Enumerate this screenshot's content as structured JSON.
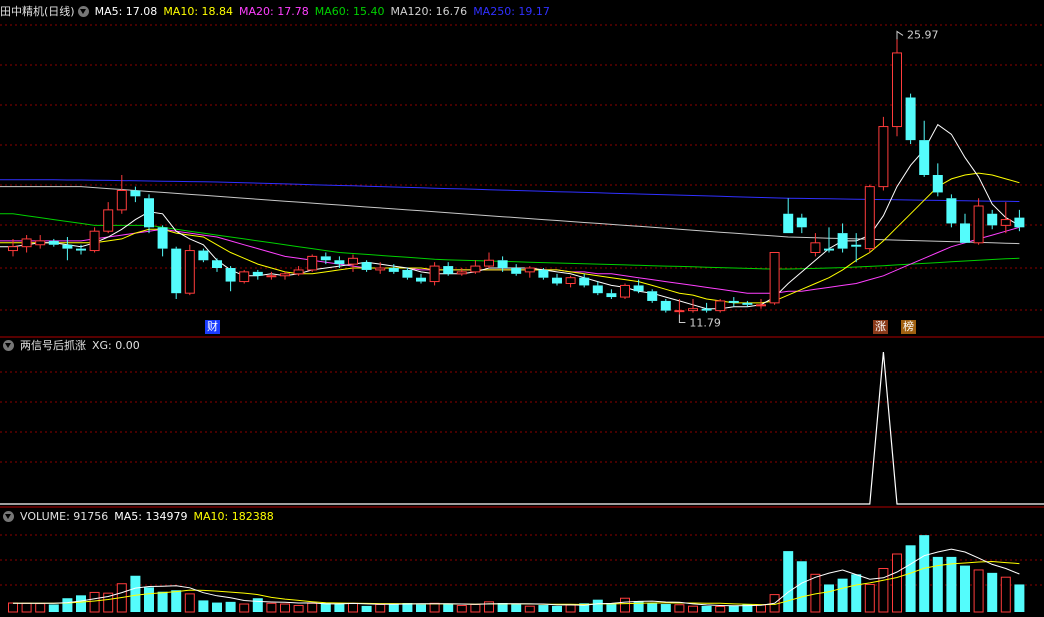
{
  "main_header": {
    "title": "田中精机(日线)",
    "ma5": "MA5: 17.08",
    "ma10": "MA10: 18.84",
    "ma20": "MA20: 17.78",
    "ma60": "MA60: 15.40",
    "ma120": "MA120: 16.76",
    "ma250": "MA250: 19.17"
  },
  "indicator_header": {
    "title": "两信号后抓涨",
    "xg": "XG: 0.00"
  },
  "volume_header": {
    "volume": "VOLUME: 91756",
    "ma5": "MA5: 134979",
    "ma10": "MA10: 182388"
  },
  "annotations": {
    "high": "25.97",
    "low": "11.79",
    "tag_cai": "财",
    "tag_zhang": "涨",
    "tag_bang": "榜"
  },
  "colors": {
    "up": "#ff3c3c",
    "down": "#54fcfc",
    "ma5": "#ffffff",
    "ma10": "#ffff00",
    "ma20": "#ff40ff",
    "ma60": "#00d000",
    "ma120": "#c8c8c8",
    "ma250": "#3030ff",
    "grid": "#8b0000"
  },
  "chart_data": [
    {
      "type": "candlestick",
      "title": "田中精机(日线)",
      "ylim": [
        11.0,
        27.0
      ],
      "candles": [
        [
          15.1,
          15.7,
          14.8,
          15.3
        ],
        [
          15.3,
          15.9,
          15.0,
          15.7
        ],
        [
          15.4,
          15.9,
          15.2,
          15.6
        ],
        [
          15.6,
          15.7,
          15.3,
          15.4
        ],
        [
          15.4,
          15.8,
          14.6,
          15.2
        ],
        [
          15.2,
          15.4,
          14.9,
          15.1
        ],
        [
          15.1,
          16.3,
          15.0,
          16.1
        ],
        [
          16.1,
          17.6,
          16.0,
          17.2
        ],
        [
          17.2,
          19.0,
          17.0,
          18.2
        ],
        [
          18.2,
          18.4,
          17.6,
          17.9
        ],
        [
          17.8,
          18.0,
          16.0,
          16.3
        ],
        [
          16.3,
          16.4,
          14.8,
          15.2
        ],
        [
          15.2,
          15.3,
          12.6,
          12.9
        ],
        [
          12.9,
          15.4,
          12.8,
          15.1
        ],
        [
          15.1,
          15.2,
          14.5,
          14.6
        ],
        [
          14.6,
          14.7,
          14.0,
          14.2
        ],
        [
          14.2,
          14.3,
          13.0,
          13.5
        ],
        [
          13.5,
          14.1,
          13.4,
          14.0
        ],
        [
          14.0,
          14.1,
          13.6,
          13.8
        ],
        [
          13.8,
          14.0,
          13.6,
          13.8
        ],
        [
          13.8,
          14.0,
          13.6,
          13.9
        ],
        [
          13.9,
          14.3,
          13.8,
          14.1
        ],
        [
          14.1,
          14.9,
          14.0,
          14.8
        ],
        [
          14.8,
          15.0,
          14.4,
          14.6
        ],
        [
          14.6,
          14.8,
          14.2,
          14.4
        ],
        [
          14.4,
          14.9,
          14.0,
          14.7
        ],
        [
          14.5,
          14.6,
          14.0,
          14.1
        ],
        [
          14.1,
          14.5,
          13.9,
          14.2
        ],
        [
          14.2,
          14.4,
          13.9,
          14.0
        ],
        [
          14.1,
          14.2,
          13.6,
          13.7
        ],
        [
          13.7,
          13.9,
          13.4,
          13.5
        ],
        [
          13.5,
          14.5,
          13.3,
          14.3
        ],
        [
          14.3,
          14.5,
          13.8,
          13.9
        ],
        [
          13.9,
          14.2,
          13.8,
          14.0
        ],
        [
          14.0,
          14.6,
          13.9,
          14.3
        ],
        [
          14.3,
          15.0,
          14.2,
          14.6
        ],
        [
          14.6,
          14.8,
          14.0,
          14.2
        ],
        [
          14.2,
          14.4,
          13.8,
          13.9
        ],
        [
          14.0,
          14.3,
          13.7,
          14.2
        ],
        [
          14.1,
          14.2,
          13.6,
          13.7
        ],
        [
          13.7,
          13.9,
          13.3,
          13.4
        ],
        [
          13.4,
          13.8,
          13.2,
          13.7
        ],
        [
          13.7,
          13.9,
          13.2,
          13.3
        ],
        [
          13.3,
          13.5,
          12.8,
          12.9
        ],
        [
          12.9,
          13.1,
          12.6,
          12.7
        ],
        [
          12.7,
          13.4,
          12.6,
          13.3
        ],
        [
          13.3,
          13.6,
          12.9,
          13.0
        ],
        [
          13.0,
          13.1,
          12.4,
          12.5
        ],
        [
          12.5,
          12.6,
          11.9,
          12.0
        ],
        [
          12.0,
          12.6,
          11.8,
          12.0
        ],
        [
          12.0,
          12.6,
          11.9,
          12.1
        ],
        [
          12.1,
          12.4,
          11.9,
          12.0
        ],
        [
          12.0,
          12.6,
          11.9,
          12.5
        ],
        [
          12.5,
          12.7,
          12.2,
          12.4
        ],
        [
          12.4,
          12.5,
          12.2,
          12.3
        ],
        [
          12.3,
          12.6,
          12.1,
          12.3
        ],
        [
          12.4,
          15.0,
          12.3,
          15.0
        ],
        [
          17.0,
          17.8,
          16.0,
          16.0
        ],
        [
          16.8,
          17.0,
          16.0,
          16.3
        ],
        [
          15.0,
          16.0,
          14.8,
          15.5
        ],
        [
          15.2,
          16.3,
          15.0,
          15.1
        ],
        [
          16.0,
          16.5,
          15.0,
          15.2
        ],
        [
          15.4,
          16.0,
          14.5,
          15.3
        ],
        [
          15.2,
          18.5,
          15.0,
          18.4
        ],
        [
          18.4,
          22.0,
          18.2,
          21.5
        ],
        [
          21.5,
          26.0,
          21.0,
          25.3
        ],
        [
          23.0,
          23.2,
          20.6,
          20.8
        ],
        [
          20.8,
          21.8,
          18.9,
          19.0
        ],
        [
          19.0,
          19.6,
          17.9,
          18.1
        ],
        [
          17.8,
          18.0,
          16.3,
          16.5
        ],
        [
          16.5,
          17.0,
          15.5,
          15.5
        ],
        [
          15.5,
          17.8,
          15.4,
          17.4
        ],
        [
          17.0,
          17.2,
          16.2,
          16.4
        ],
        [
          16.4,
          17.6,
          16.0,
          16.7
        ],
        [
          16.8,
          17.2,
          16.1,
          16.3
        ]
      ],
      "ma5": [
        15.3,
        15.4,
        15.5,
        15.5,
        15.4,
        15.3,
        15.5,
        15.8,
        16.2,
        16.7,
        17.1,
        17.0,
        16.1,
        15.7,
        15.4,
        14.6,
        14.1,
        13.8,
        13.8,
        13.9,
        13.8,
        13.9,
        14.1,
        14.2,
        14.3,
        14.4,
        14.5,
        14.4,
        14.3,
        14.2,
        14.0,
        13.9,
        13.9,
        13.9,
        14.0,
        14.2,
        14.2,
        14.2,
        14.2,
        14.1,
        14.0,
        13.9,
        13.7,
        13.5,
        13.3,
        13.2,
        13.0,
        12.9,
        12.7,
        12.5,
        12.3,
        12.1,
        12.1,
        12.2,
        12.2,
        12.3,
        12.7,
        13.4,
        14.0,
        14.6,
        15.2,
        15.6,
        15.6,
        15.9,
        16.9,
        18.4,
        19.5,
        20.3,
        21.6,
        21.1,
        19.9,
        18.9,
        17.5,
        16.8,
        16.4
      ],
      "ma10": [
        15.5,
        15.5,
        15.5,
        15.5,
        15.5,
        15.5,
        15.5,
        15.6,
        15.7,
        16.0,
        16.2,
        16.2,
        16.0,
        15.9,
        15.8,
        15.4,
        15.0,
        14.7,
        14.4,
        14.2,
        14.0,
        13.9,
        13.9,
        14.0,
        14.1,
        14.2,
        14.2,
        14.2,
        14.2,
        14.2,
        14.2,
        14.1,
        14.1,
        14.1,
        14.1,
        14.1,
        14.1,
        14.1,
        14.1,
        14.1,
        14.1,
        14.0,
        13.9,
        13.8,
        13.7,
        13.6,
        13.5,
        13.3,
        13.1,
        12.9,
        12.8,
        12.6,
        12.5,
        12.4,
        12.4,
        12.4,
        12.5,
        12.8,
        13.1,
        13.4,
        13.7,
        14.1,
        14.6,
        15.0,
        15.6,
        16.3,
        17.0,
        17.7,
        18.4,
        18.8,
        19.0,
        19.1,
        19.0,
        18.8,
        18.6
      ],
      "ma20": [
        15.6,
        15.6,
        15.6,
        15.6,
        15.6,
        15.6,
        15.7,
        15.8,
        15.9,
        16.0,
        16.1,
        16.2,
        16.1,
        16.0,
        15.9,
        15.8,
        15.6,
        15.4,
        15.2,
        15.0,
        14.8,
        14.7,
        14.6,
        14.5,
        14.4,
        14.3,
        14.2,
        14.2,
        14.2,
        14.2,
        14.1,
        14.1,
        14.1,
        14.1,
        14.1,
        14.1,
        14.1,
        14.1,
        14.1,
        14.1,
        14.1,
        14.0,
        14.0,
        13.9,
        13.9,
        13.8,
        13.7,
        13.6,
        13.5,
        13.4,
        13.3,
        13.2,
        13.1,
        13.0,
        12.9,
        12.9,
        12.9,
        13.0,
        13.0,
        13.1,
        13.2,
        13.3,
        13.4,
        13.6,
        13.8,
        14.1,
        14.4,
        14.7,
        15.0,
        15.3,
        15.5,
        15.7,
        15.9,
        16.1,
        16.3
      ],
      "ma60": [
        17.0,
        16.9,
        16.8,
        16.7,
        16.6,
        16.5,
        16.4,
        16.4,
        16.4,
        16.4,
        16.4,
        16.3,
        16.2,
        16.1,
        16.0,
        15.9,
        15.8,
        15.7,
        15.6,
        15.5,
        15.4,
        15.3,
        15.2,
        15.1,
        15.0,
        14.95,
        14.9,
        14.85,
        14.8,
        14.75,
        14.7,
        14.65,
        14.62,
        14.6,
        14.58,
        14.56,
        14.54,
        14.52,
        14.5,
        14.48,
        14.46,
        14.44,
        14.42,
        14.4,
        14.38,
        14.36,
        14.34,
        14.32,
        14.3,
        14.28,
        14.26,
        14.24,
        14.22,
        14.2,
        14.18,
        14.16,
        14.15,
        14.15,
        14.16,
        14.18,
        14.2,
        14.22,
        14.25,
        14.28,
        14.32,
        14.36,
        14.4,
        14.44,
        14.48,
        14.52,
        14.56,
        14.6,
        14.64,
        14.68,
        14.7
      ],
      "ma120": [
        18.4,
        18.4,
        18.4,
        18.4,
        18.4,
        18.4,
        18.35,
        18.3,
        18.25,
        18.2,
        18.15,
        18.1,
        18.05,
        18.0,
        17.95,
        17.9,
        17.85,
        17.8,
        17.75,
        17.7,
        17.65,
        17.6,
        17.55,
        17.5,
        17.45,
        17.4,
        17.35,
        17.3,
        17.25,
        17.2,
        17.15,
        17.1,
        17.05,
        17.0,
        16.95,
        16.9,
        16.85,
        16.8,
        16.75,
        16.7,
        16.65,
        16.6,
        16.55,
        16.5,
        16.45,
        16.4,
        16.35,
        16.3,
        16.25,
        16.2,
        16.15,
        16.1,
        16.05,
        16.0,
        15.95,
        15.9,
        15.85,
        15.8,
        15.78,
        15.76,
        15.74,
        15.72,
        15.7,
        15.68,
        15.66,
        15.64,
        15.62,
        15.6,
        15.58,
        15.56,
        15.54,
        15.52,
        15.5,
        15.48,
        15.46
      ],
      "ma250": [
        18.75,
        18.75,
        18.75,
        18.75,
        18.74,
        18.74,
        18.73,
        18.72,
        18.71,
        18.7,
        18.69,
        18.68,
        18.67,
        18.66,
        18.65,
        18.64,
        18.62,
        18.6,
        18.58,
        18.56,
        18.54,
        18.52,
        18.5,
        18.48,
        18.46,
        18.44,
        18.42,
        18.4,
        18.38,
        18.36,
        18.34,
        18.32,
        18.3,
        18.28,
        18.26,
        18.24,
        18.22,
        18.2,
        18.18,
        18.16,
        18.14,
        18.12,
        18.1,
        18.08,
        18.06,
        18.04,
        18.02,
        18.0,
        17.98,
        17.96,
        17.94,
        17.92,
        17.9,
        17.88,
        17.86,
        17.84,
        17.82,
        17.8,
        17.79,
        17.78,
        17.77,
        17.76,
        17.75,
        17.74,
        17.73,
        17.72,
        17.71,
        17.7,
        17.69,
        17.68,
        17.67,
        17.66,
        17.65,
        17.64,
        17.63
      ]
    },
    {
      "type": "line",
      "title": "两信号后抓涨",
      "ylim": [
        0,
        1
      ],
      "values": [
        0,
        0,
        0,
        0,
        0,
        0,
        0,
        0,
        0,
        0,
        0,
        0,
        0,
        0,
        0,
        0,
        0,
        0,
        0,
        0,
        0,
        0,
        0,
        0,
        0,
        0,
        0,
        0,
        0,
        0,
        0,
        0,
        0,
        0,
        0,
        0,
        0,
        0,
        0,
        0,
        0,
        0,
        0,
        0,
        0,
        0,
        0,
        0,
        0,
        0,
        0,
        0,
        0,
        0,
        0,
        0,
        0,
        0,
        0,
        0,
        0,
        0,
        0,
        0,
        1,
        0,
        0,
        0,
        0,
        0,
        0,
        0,
        0,
        0,
        0
      ]
    },
    {
      "type": "bar",
      "title": "VOLUME",
      "ylim": [
        0,
        600000
      ],
      "values": [
        62000,
        60000,
        58000,
        52000,
        95000,
        115000,
        135000,
        130000,
        195000,
        250000,
        170000,
        140000,
        150000,
        125000,
        80000,
        65000,
        70000,
        55000,
        95000,
        60000,
        55000,
        45000,
        60000,
        62000,
        58000,
        60000,
        42000,
        52000,
        58000,
        62000,
        52000,
        60000,
        55000,
        45000,
        52000,
        70000,
        62000,
        55000,
        40000,
        48000,
        42000,
        48000,
        60000,
        85000,
        60000,
        95000,
        75000,
        60000,
        55000,
        50000,
        40000,
        42000,
        38000,
        45000,
        55000,
        48000,
        120000,
        420000,
        350000,
        260000,
        190000,
        230000,
        260000,
        190000,
        300000,
        400000,
        460000,
        530000,
        380000,
        380000,
        320000,
        290000,
        270000,
        240000,
        190000
      ],
      "ma5": [
        60000,
        60000,
        60000,
        60000,
        65000,
        76000,
        91000,
        107000,
        134000,
        165000,
        176000,
        177000,
        181000,
        167000,
        133000,
        112000,
        98000,
        79000,
        73000,
        69000,
        67000,
        62000,
        63000,
        56000,
        56000,
        59000,
        56000,
        54000,
        54000,
        55000,
        57000,
        57000,
        57000,
        55000,
        53000,
        56000,
        57000,
        57000,
        56000,
        55000,
        49000,
        49000,
        47000,
        57000,
        59000,
        68000,
        73000,
        75000,
        69000,
        67000,
        56000,
        49000,
        45000,
        43000,
        44000,
        46000,
        60000,
        137000,
        199000,
        239000,
        268000,
        290000,
        258000,
        226000,
        236000,
        276000,
        330000,
        388000,
        414000,
        434000,
        414000,
        372000,
        328000,
        300000,
        262000
      ],
      "ma10": [
        60000,
        60000,
        60000,
        60000,
        62000,
        68000,
        76000,
        86000,
        100000,
        115000,
        126000,
        133000,
        141000,
        151000,
        149000,
        144000,
        137000,
        130000,
        120000,
        101000,
        89000,
        80000,
        71000,
        64000,
        62000,
        60000,
        59000,
        58000,
        58000,
        57000,
        56000,
        56000,
        56000,
        55000,
        54000,
        56000,
        56000,
        56000,
        56000,
        54000,
        53000,
        53000,
        52000,
        56000,
        56000,
        58000,
        60000,
        62000,
        63000,
        62000,
        62000,
        61000,
        60000,
        56000,
        53000,
        51000,
        52000,
        77000,
        104000,
        125000,
        140000,
        164000,
        186000,
        201000,
        219000,
        238000,
        268000,
        302000,
        320000,
        332000,
        338000,
        345000,
        348000,
        341000,
        334000
      ]
    }
  ]
}
